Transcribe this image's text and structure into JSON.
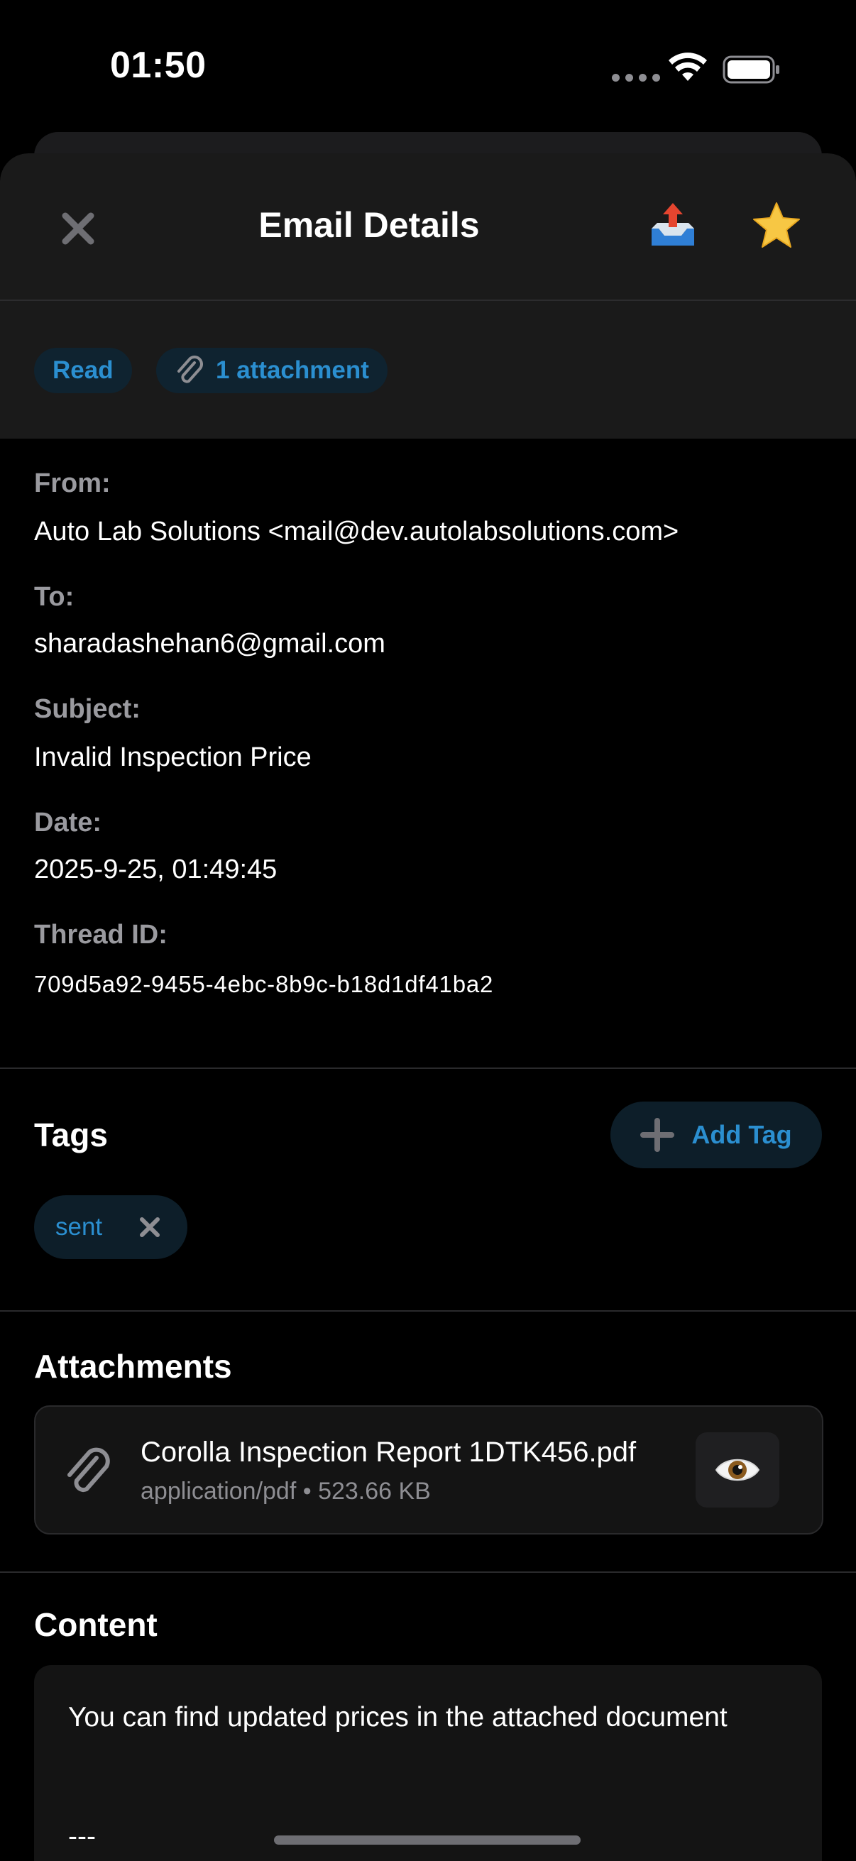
{
  "status_bar": {
    "time": "01:50"
  },
  "header": {
    "title": "Email Details"
  },
  "status_chips": {
    "read": "Read",
    "attachments": "1 attachment"
  },
  "details": {
    "from_label": "From:",
    "from_value": "Auto Lab Solutions <mail@dev.autolabsolutions.com>",
    "to_label": "To:",
    "to_value": "sharadashehan6@gmail.com",
    "subject_label": "Subject:",
    "subject_value": "Invalid Inspection Price",
    "date_label": "Date:",
    "date_value": "2025-9-25, 01:49:45",
    "thread_label": "Thread ID:",
    "thread_value": "709d5a92-9455-4ebc-8b9c-b18d1df41ba2"
  },
  "tags": {
    "title": "Tags",
    "add_label": "Add Tag",
    "items": [
      {
        "label": "sent"
      }
    ]
  },
  "attachments": {
    "title": "Attachments",
    "items": [
      {
        "name": "Corolla Inspection Report 1DTK456.pdf",
        "meta": "application/pdf • 523.66 KB"
      }
    ]
  },
  "content": {
    "title": "Content",
    "body": "You can find updated prices in the attached document",
    "separator": "---"
  },
  "colors": {
    "accent": "#2b8fd0",
    "background": "#000000",
    "panel": "#1a1a1a"
  }
}
